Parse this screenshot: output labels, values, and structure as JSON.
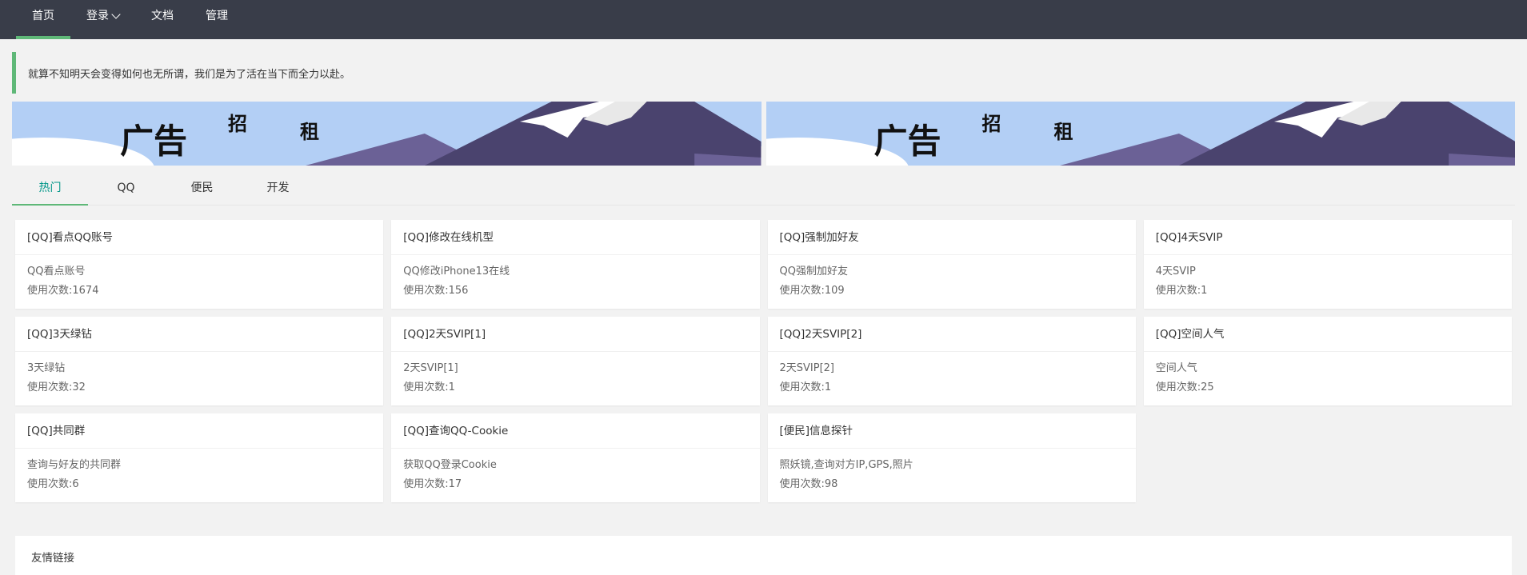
{
  "nav": {
    "items": [
      {
        "label": "首页",
        "active": true
      },
      {
        "label": "登录",
        "has_dropdown": true
      },
      {
        "label": "文档"
      },
      {
        "label": "管理"
      }
    ]
  },
  "notice": {
    "text": "就算不知明天会变得如何也无所谓，我们是为了活在当下而全力以赴。"
  },
  "ads": [
    {
      "chars": [
        "广告",
        "招",
        "租"
      ]
    },
    {
      "chars": [
        "广告",
        "招",
        "租"
      ]
    }
  ],
  "tabs": [
    {
      "label": "热门",
      "active": true
    },
    {
      "label": "QQ"
    },
    {
      "label": "便民"
    },
    {
      "label": "开发"
    }
  ],
  "cards": [
    {
      "title": "[QQ]看点QQ账号",
      "desc": "QQ看点账号",
      "usage": "使用次数:1674"
    },
    {
      "title": "[QQ]修改在线机型",
      "desc": "QQ修改iPhone13在线",
      "usage": "使用次数:156"
    },
    {
      "title": "[QQ]强制加好友",
      "desc": "QQ强制加好友",
      "usage": "使用次数:109"
    },
    {
      "title": "[QQ]4天SVIP",
      "desc": "4天SVIP",
      "usage": "使用次数:1"
    },
    {
      "title": "[QQ]3天绿钻",
      "desc": "3天绿钻",
      "usage": "使用次数:32"
    },
    {
      "title": "[QQ]2天SVIP[1]",
      "desc": "2天SVIP[1]",
      "usage": "使用次数:1"
    },
    {
      "title": "[QQ]2天SVIP[2]",
      "desc": "2天SVIP[2]",
      "usage": "使用次数:1"
    },
    {
      "title": "[QQ]空间人气",
      "desc": "空间人气",
      "usage": "使用次数:25"
    },
    {
      "title": "[QQ]共同群",
      "desc": "查询与好友的共同群",
      "usage": "使用次数:6"
    },
    {
      "title": "[QQ]查询QQ-Cookie",
      "desc": "获取QQ登录Cookie",
      "usage": "使用次数:17"
    },
    {
      "title": "[便民]信息探针",
      "desc": "照妖镜,查询对方IP,GPS,照片",
      "usage": "使用次数:98"
    }
  ],
  "links": {
    "title": "友情链接"
  },
  "colors": {
    "nav_bg": "#393d49",
    "accent": "#5fb878",
    "tab_active": "#009688"
  }
}
